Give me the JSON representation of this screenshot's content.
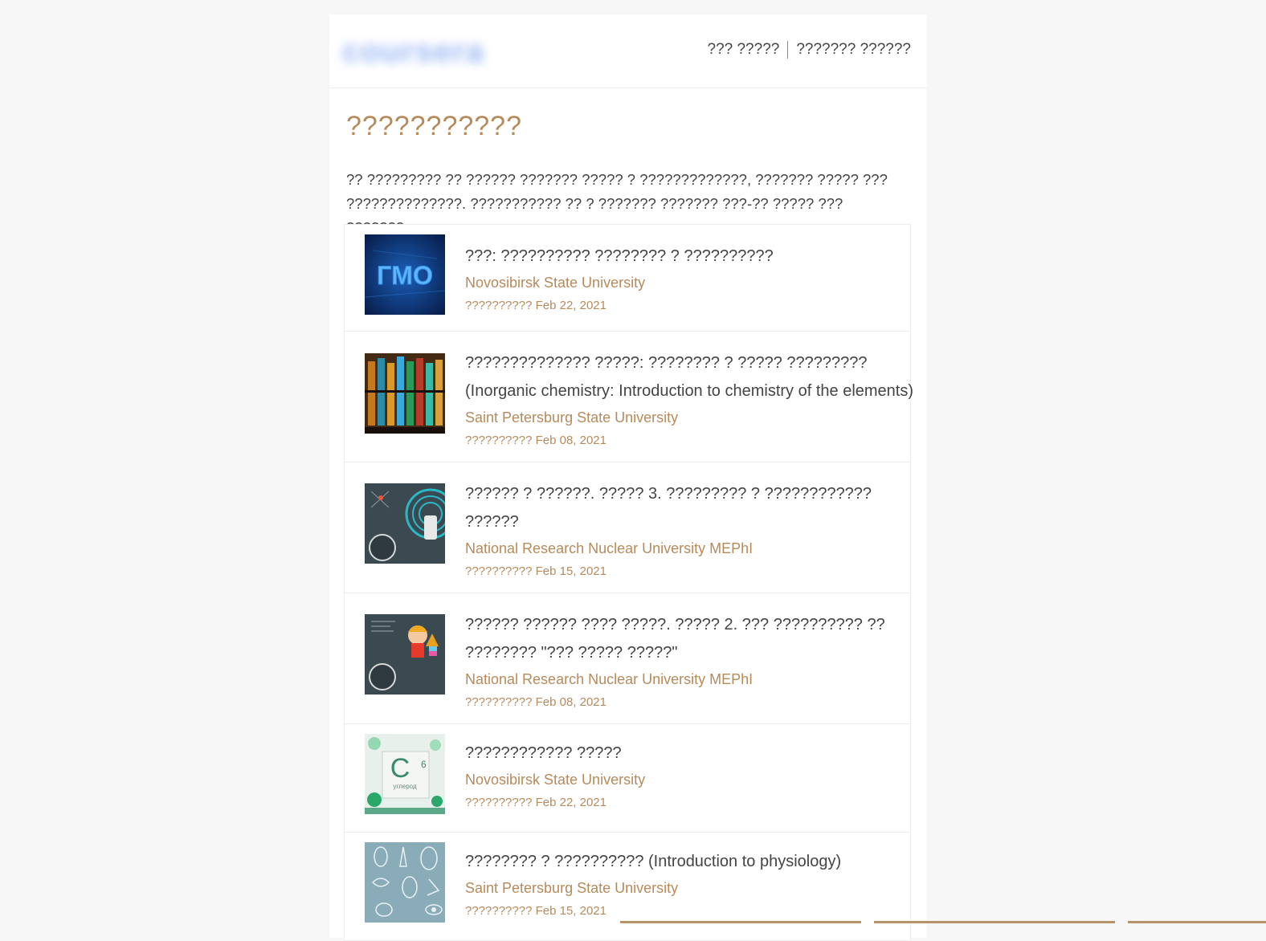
{
  "header": {
    "logo_text": "coursera",
    "link_1": "??? ?????",
    "link_2": "??????? ??????"
  },
  "main": {
    "title": "???????????",
    "intro_line_1": "?? ????????? ?? ?????? ??????? ????? ? ?????????????, ??????? ????? ???",
    "intro_line_2": "??????????????. ??????????? ?? ? ??????? ??????? ???-?? ????? ??? ???????."
  },
  "courses": [
    {
      "title_lines": [
        "???: ?????????? ???????? ? ??????????"
      ],
      "university": "Novosibirsk State University",
      "date": "?????????? Feb 22, 2021",
      "thumb_text": "ГМО"
    },
    {
      "title_lines": [
        "?????????????? ?????: ???????? ? ????? ?????????",
        "(Inorganic chemistry: Introduction to chemistry of the elements)"
      ],
      "university": "Saint Petersburg State University",
      "date": "?????????? Feb 08, 2021"
    },
    {
      "title_lines": [
        "?????? ? ??????. ????? 3. ????????? ? ????????????",
        "??????"
      ],
      "university": "National Research Nuclear University MEPhI",
      "date": "?????????? Feb 15, 2021"
    },
    {
      "title_lines": [
        "?????? ?????? ???? ?????. ????? 2. ??? ?????????? ??",
        "???????? \"??? ????? ?????\""
      ],
      "university": "National Research Nuclear University MEPhI",
      "date": "?????????? Feb 08, 2021"
    },
    {
      "title_lines": [
        "???????????? ?????"
      ],
      "university": "Novosibirsk State University",
      "date": "?????????? Feb 22, 2021",
      "thumb_text": "C",
      "thumb_sup": "6",
      "thumb_label": "углерод"
    },
    {
      "title_lines": [
        "???????? ? ?????????? (Introduction to physiology)"
      ],
      "university": "Saint Petersburg State University",
      "date": "?????????? Feb 15, 2021"
    }
  ],
  "colors": {
    "accent": "#b78a5c",
    "text": "#444444",
    "background": "#f7f7f7"
  }
}
